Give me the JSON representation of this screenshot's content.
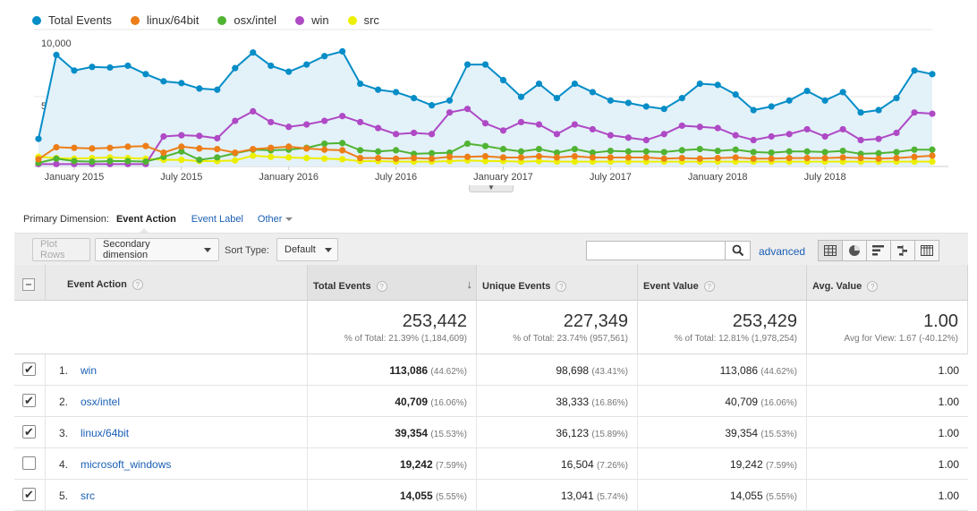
{
  "chart_data": {
    "type": "line",
    "series": [
      {
        "name": "Total Events",
        "color": "#058dc7",
        "values": [
          2300,
          9300,
          8000,
          8300,
          8250,
          8400,
          7700,
          7100,
          6950,
          6500,
          6400,
          8200,
          9500,
          8400,
          7900,
          8500,
          9200,
          9600,
          6900,
          6400,
          6200,
          5700,
          5100,
          5500,
          8500,
          8500,
          7200,
          5800,
          6900,
          5700,
          6900,
          6200,
          5500,
          5300,
          5000,
          4800,
          5700,
          6900,
          6800,
          6000,
          4700,
          5000,
          5500,
          6300,
          5500,
          6200,
          4500,
          4700,
          5700,
          8000,
          7700
        ]
      },
      {
        "name": "linux/64bit",
        "color": "#ed7e17",
        "values": [
          600,
          1600,
          1550,
          1500,
          1550,
          1650,
          1700,
          1150,
          1650,
          1500,
          1450,
          1150,
          1450,
          1550,
          1650,
          1500,
          1400,
          1350,
          700,
          700,
          650,
          700,
          650,
          800,
          800,
          850,
          750,
          750,
          850,
          750,
          850,
          750,
          750,
          750,
          750,
          650,
          700,
          650,
          700,
          750,
          650,
          650,
          700,
          700,
          700,
          750,
          700,
          650,
          700,
          800,
          900
        ]
      },
      {
        "name": "osx/intel",
        "color": "#50b432",
        "values": [
          300,
          650,
          450,
          400,
          450,
          450,
          400,
          800,
          1250,
          550,
          750,
          1100,
          1400,
          1350,
          1400,
          1550,
          1900,
          1950,
          1350,
          1250,
          1350,
          1050,
          1100,
          1150,
          1900,
          1700,
          1450,
          1250,
          1450,
          1150,
          1450,
          1150,
          1300,
          1250,
          1250,
          1200,
          1350,
          1450,
          1300,
          1400,
          1200,
          1150,
          1250,
          1250,
          1200,
          1300,
          1050,
          1100,
          1200,
          1400,
          1400
        ]
      },
      {
        "name": "win",
        "color": "#af49c5",
        "values": [
          200,
          200,
          200,
          200,
          200,
          200,
          200,
          2500,
          2600,
          2550,
          2350,
          3800,
          4600,
          3700,
          3300,
          3500,
          3800,
          4200,
          3700,
          3200,
          2700,
          2800,
          2700,
          4500,
          4800,
          3600,
          3000,
          3700,
          3500,
          2700,
          3500,
          3100,
          2600,
          2400,
          2200,
          2700,
          3400,
          3300,
          3200,
          2600,
          2200,
          2500,
          2700,
          3100,
          2500,
          3100,
          2200,
          2300,
          2800,
          4500,
          4400
        ]
      },
      {
        "name": "src",
        "color": "#edef00",
        "values": [
          800,
          700,
          650,
          700,
          750,
          700,
          650,
          550,
          550,
          450,
          450,
          500,
          900,
          800,
          750,
          700,
          650,
          600,
          450,
          450,
          400,
          400,
          400,
          450,
          500,
          450,
          450,
          400,
          450,
          400,
          400,
          400,
          400,
          400,
          400,
          400,
          400,
          400,
          400,
          400,
          400,
          400,
          400,
          400,
          400,
          400,
          400,
          400,
          400,
          400,
          400
        ]
      }
    ],
    "x_tick_labels": [
      "January 2015",
      "July 2015",
      "January 2016",
      "July 2016",
      "January 2017",
      "July 2017",
      "January 2018",
      "July 2018"
    ],
    "y_tick_labels": [
      "10,000",
      "5,000"
    ],
    "ylim": [
      0,
      10000
    ],
    "area_fill_series": "Total Events",
    "grid": true,
    "legend_position": "top-left"
  },
  "dimension_bar": {
    "label": "Primary Dimension:",
    "active": "Event Action",
    "link": "Event Label",
    "other": "Other"
  },
  "toolbar": {
    "plot_rows": "Plot Rows",
    "secondary_dimension": "Secondary dimension",
    "sort_type_label": "Sort Type:",
    "sort_type_value": "Default",
    "search_value": "",
    "advanced": "advanced"
  },
  "table": {
    "headers": {
      "event_action": "Event Action",
      "total_events": "Total Events",
      "unique_events": "Unique Events",
      "event_value": "Event Value",
      "avg_value": "Avg. Value"
    },
    "totals": {
      "total_events": {
        "value": "253,442",
        "note": "% of Total: 21.39% (1,184,609)"
      },
      "unique_events": {
        "value": "227,349",
        "note": "% of Total: 23.74% (957,561)"
      },
      "event_value": {
        "value": "253,429",
        "note": "% of Total: 12.81% (1,978,254)"
      },
      "avg_value": {
        "value": "1.00",
        "note": "Avg for View: 1.67 (-40.12%)"
      }
    },
    "rows": [
      {
        "checked": true,
        "rank": "1.",
        "action": "win",
        "total": "113,086",
        "total_pct": "(44.62%)",
        "unique": "98,698",
        "unique_pct": "(43.41%)",
        "value": "113,086",
        "value_pct": "(44.62%)",
        "avg": "1.00"
      },
      {
        "checked": true,
        "rank": "2.",
        "action": "osx/intel",
        "total": "40,709",
        "total_pct": "(16.06%)",
        "unique": "38,333",
        "unique_pct": "(16.86%)",
        "value": "40,709",
        "value_pct": "(16.06%)",
        "avg": "1.00"
      },
      {
        "checked": true,
        "rank": "3.",
        "action": "linux/64bit",
        "total": "39,354",
        "total_pct": "(15.53%)",
        "unique": "36,123",
        "unique_pct": "(15.89%)",
        "value": "39,354",
        "value_pct": "(15.53%)",
        "avg": "1.00"
      },
      {
        "checked": false,
        "rank": "4.",
        "action": "microsoft_windows",
        "total": "19,242",
        "total_pct": "(7.59%)",
        "unique": "16,504",
        "unique_pct": "(7.26%)",
        "value": "19,242",
        "value_pct": "(7.59%)",
        "avg": "1.00"
      },
      {
        "checked": true,
        "rank": "5.",
        "action": "src",
        "total": "14,055",
        "total_pct": "(5.55%)",
        "unique": "13,041",
        "unique_pct": "(5.74%)",
        "value": "14,055",
        "value_pct": "(5.55%)",
        "avg": "1.00"
      }
    ]
  }
}
